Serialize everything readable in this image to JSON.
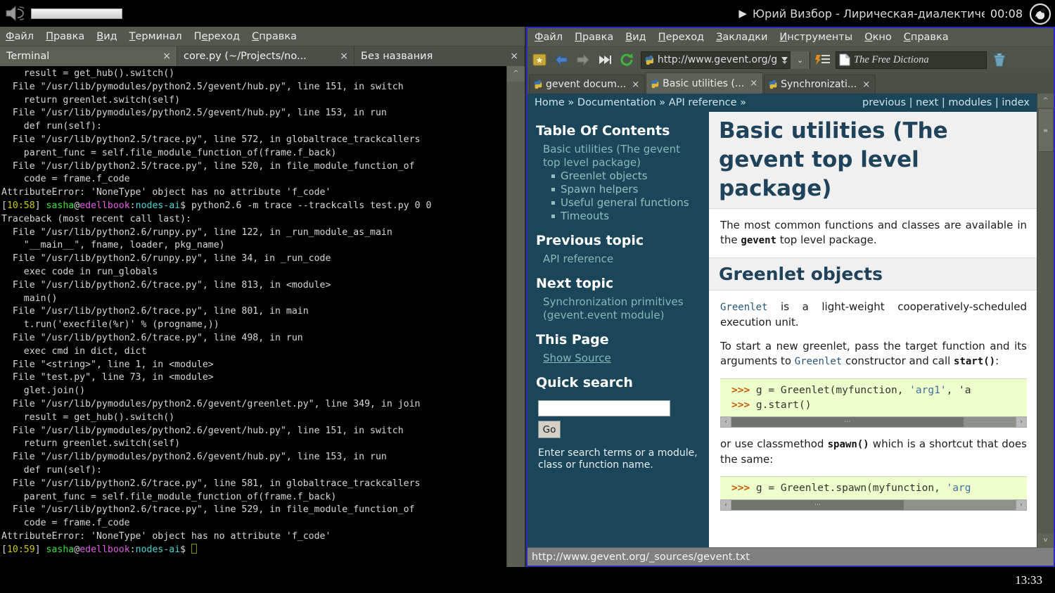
{
  "top_panel": {
    "speaker_icon": "speaker-icon",
    "volume_slider": "volume-slider",
    "play_glyph": "▶",
    "media_title": "Юрий Визбор - Лирическая-диалектическая",
    "media_time": "00:08",
    "tray_icon": "gnome-tray-icon"
  },
  "terminal": {
    "menu": [
      {
        "accel": "Ф",
        "rest": "айл"
      },
      {
        "accel": "П",
        "rest": "равка"
      },
      {
        "accel": "В",
        "rest": "ид"
      },
      {
        "accel": "Т",
        "rest": "ерминал"
      },
      {
        "accel": "П",
        "rest": "ереход",
        "accel_index": 1,
        "pre": "П"
      },
      {
        "accel": "С",
        "rest": "правка"
      }
    ],
    "menu_labels": [
      "Файл",
      "Правка",
      "Вид",
      "Терминал",
      "Переход",
      "Справка"
    ],
    "tabs": [
      {
        "label": "Terminal",
        "close": "×",
        "active": true
      },
      {
        "label": "core.py (~/Projects/no...",
        "close": "×",
        "active": false
      },
      {
        "label": "Без названия",
        "close": "×",
        "active": false
      }
    ],
    "scroll_up_glyph": "^",
    "lines": [
      {
        "segments": [
          {
            "t": "    result = get_hub().switch()",
            "c": "c-white"
          }
        ]
      },
      {
        "segments": [
          {
            "t": "  File \"/usr/lib/pymodules/python2.5/gevent/hub.py\", line 151, in switch",
            "c": "c-white"
          }
        ]
      },
      {
        "segments": [
          {
            "t": "    return greenlet.switch(self)",
            "c": "c-white"
          }
        ]
      },
      {
        "segments": [
          {
            "t": "  File \"/usr/lib/pymodules/python2.5/gevent/hub.py\", line 153, in run",
            "c": "c-white"
          }
        ]
      },
      {
        "segments": [
          {
            "t": "    def run(self):",
            "c": "c-white"
          }
        ]
      },
      {
        "segments": [
          {
            "t": "  File \"/usr/lib/python2.5/trace.py\", line 572, in globaltrace_trackcallers",
            "c": "c-white"
          }
        ]
      },
      {
        "segments": [
          {
            "t": "    parent_func = self.file_module_function_of(frame.f_back)",
            "c": "c-white"
          }
        ]
      },
      {
        "segments": [
          {
            "t": "  File \"/usr/lib/python2.5/trace.py\", line 520, in file_module_function_of",
            "c": "c-white"
          }
        ]
      },
      {
        "segments": [
          {
            "t": "    code = frame.f_code",
            "c": "c-white"
          }
        ]
      },
      {
        "segments": [
          {
            "t": "AttributeError: 'NoneType' object has no attribute 'f_code'",
            "c": "c-white"
          }
        ]
      },
      {
        "segments": [
          {
            "t": "[",
            "c": "c-white"
          },
          {
            "t": "10:58",
            "c": "c-yellow"
          },
          {
            "t": "] ",
            "c": "c-white"
          },
          {
            "t": "sasha",
            "c": "c-green"
          },
          {
            "t": "@",
            "c": "c-white"
          },
          {
            "t": "edellbook",
            "c": "c-magenta"
          },
          {
            "t": ":",
            "c": "c-white"
          },
          {
            "t": "nodes-ai",
            "c": "c-cyan"
          },
          {
            "t": "$ python2.6 -m trace --trackcalls test.py 0 0",
            "c": "c-white"
          }
        ]
      },
      {
        "segments": [
          {
            "t": "Traceback (most recent call last):",
            "c": "c-white"
          }
        ]
      },
      {
        "segments": [
          {
            "t": "  File \"/usr/lib/python2.6/runpy.py\", line 122, in _run_module_as_main",
            "c": "c-white"
          }
        ]
      },
      {
        "segments": [
          {
            "t": "    \"__main__\", fname, loader, pkg_name)",
            "c": "c-white"
          }
        ]
      },
      {
        "segments": [
          {
            "t": "  File \"/usr/lib/python2.6/runpy.py\", line 34, in _run_code",
            "c": "c-white"
          }
        ]
      },
      {
        "segments": [
          {
            "t": "    exec code in run_globals",
            "c": "c-white"
          }
        ]
      },
      {
        "segments": [
          {
            "t": "  File \"/usr/lib/python2.6/trace.py\", line 813, in <module>",
            "c": "c-white"
          }
        ]
      },
      {
        "segments": [
          {
            "t": "    main()",
            "c": "c-white"
          }
        ]
      },
      {
        "segments": [
          {
            "t": "  File \"/usr/lib/python2.6/trace.py\", line 801, in main",
            "c": "c-white"
          }
        ]
      },
      {
        "segments": [
          {
            "t": "    t.run('execfile(%r)' % (progname,))",
            "c": "c-white"
          }
        ]
      },
      {
        "segments": [
          {
            "t": "  File \"/usr/lib/python2.6/trace.py\", line 498, in run",
            "c": "c-white"
          }
        ]
      },
      {
        "segments": [
          {
            "t": "    exec cmd in dict, dict",
            "c": "c-white"
          }
        ]
      },
      {
        "segments": [
          {
            "t": "  File \"<string>\", line 1, in <module>",
            "c": "c-white"
          }
        ]
      },
      {
        "segments": [
          {
            "t": "  File \"test.py\", line 73, in <module>",
            "c": "c-white"
          }
        ]
      },
      {
        "segments": [
          {
            "t": "    glet.join()",
            "c": "c-white"
          }
        ]
      },
      {
        "segments": [
          {
            "t": "  File \"/usr/lib/pymodules/python2.6/gevent/greenlet.py\", line 349, in join",
            "c": "c-white"
          }
        ]
      },
      {
        "segments": [
          {
            "t": "    result = get_hub().switch()",
            "c": "c-white"
          }
        ]
      },
      {
        "segments": [
          {
            "t": "  File \"/usr/lib/pymodules/python2.6/gevent/hub.py\", line 151, in switch",
            "c": "c-white"
          }
        ]
      },
      {
        "segments": [
          {
            "t": "    return greenlet.switch(self)",
            "c": "c-white"
          }
        ]
      },
      {
        "segments": [
          {
            "t": "  File \"/usr/lib/pymodules/python2.6/gevent/hub.py\", line 153, in run",
            "c": "c-white"
          }
        ]
      },
      {
        "segments": [
          {
            "t": "    def run(self):",
            "c": "c-white"
          }
        ]
      },
      {
        "segments": [
          {
            "t": "  File \"/usr/lib/python2.6/trace.py\", line 581, in globaltrace_trackcallers",
            "c": "c-white"
          }
        ]
      },
      {
        "segments": [
          {
            "t": "    parent_func = self.file_module_function_of(frame.f_back)",
            "c": "c-white"
          }
        ]
      },
      {
        "segments": [
          {
            "t": "  File \"/usr/lib/python2.6/trace.py\", line 529, in file_module_function_of",
            "c": "c-white"
          }
        ]
      },
      {
        "segments": [
          {
            "t": "    code = frame.f_code",
            "c": "c-white"
          }
        ]
      },
      {
        "segments": [
          {
            "t": "AttributeError: 'NoneType' object has no attribute 'f_code'",
            "c": "c-white"
          }
        ]
      },
      {
        "segments": [
          {
            "t": "[",
            "c": "c-white"
          },
          {
            "t": "10:59",
            "c": "c-yellow"
          },
          {
            "t": "] ",
            "c": "c-white"
          },
          {
            "t": "sasha",
            "c": "c-green"
          },
          {
            "t": "@",
            "c": "c-white"
          },
          {
            "t": "edellbook",
            "c": "c-magenta"
          },
          {
            "t": ":",
            "c": "c-white"
          },
          {
            "t": "nodes-ai",
            "c": "c-cyan"
          },
          {
            "t": "$ ",
            "c": "c-white"
          }
        ],
        "cursor": true
      }
    ]
  },
  "browser": {
    "menu_labels": [
      "Файл",
      "Правка",
      "Вид",
      "Переход",
      "Закладки",
      "Инструменты",
      "Окно",
      "Справка"
    ],
    "toolbar": {
      "new_tab_icon": "new-tab-star-icon",
      "back_icon": "back-arrow-icon",
      "forward_icon": "forward-arrow-icon",
      "skip_icon": "skip-forward-icon",
      "reload_icon": "reload-icon",
      "url_favicon": "python-favicon",
      "url_value": "http://www.gevent.org/g",
      "url_go_icon": "go-arrow-icon",
      "url_dropdown_icon": "chevron-down-icon",
      "bookmarks_menu_icon": "bookmarks-list-icon",
      "bookmark_page_icon": "page-icon",
      "bookmark_label": "The Free Dictiona",
      "trash_icon": "trash-icon"
    },
    "tabs": [
      {
        "label": "gevent docum...",
        "favicon": "python-favicon",
        "close": "×",
        "active": false
      },
      {
        "label": "Basic utilities (...",
        "favicon": "python-favicon",
        "close": "×",
        "active": true
      },
      {
        "label": "Synchronizati...",
        "favicon": "python-favicon",
        "close": "×",
        "active": false
      }
    ],
    "status_text": "http://www.gevent.org/_sources/gevent.txt"
  },
  "page": {
    "breadcrumb": "Home » Documentation » API reference »",
    "nav_links": "previous | next | modules | index",
    "sidebar": {
      "toc_heading": "Table Of Contents",
      "toc_top": "Basic utilities (The gevent top level package)",
      "toc_items": [
        "Greenlet objects",
        "Spawn helpers",
        "Useful general functions",
        "Timeouts"
      ],
      "prev_heading": "Previous topic",
      "prev_link": "API reference",
      "next_heading": "Next topic",
      "next_link": "Synchronization primitives (gevent.event module)",
      "thispage_heading": "This Page",
      "show_source": "Show Source",
      "quicksearch_heading": "Quick search",
      "search_value": "",
      "search_placeholder": "",
      "go_label": "Go",
      "search_hint": "Enter search terms or a module, class or function name."
    },
    "content": {
      "h1": "Basic utilities (The gevent top level package)",
      "p1_a": "The most common functions and classes are available in the ",
      "p1_b": "gevent",
      "p1_c": " top level package.",
      "h2": "Greenlet objects",
      "p2_a": "Greenlet",
      "p2_b": " is a light-weight cooperatively-scheduled execution unit.",
      "p3_a": "To start a new greenlet, pass the target function and its arguments to ",
      "p3_b": "Greenlet",
      "p3_c": " constructor and call ",
      "p3_d": "start()",
      "p3_e": ":",
      "code1_line1_prompt": ">>> ",
      "code1_line1_body": "g = Greenlet(myfunction, ",
      "code1_line1_str": "'arg1'",
      "code1_line1_tail": ", 'a",
      "code1_line2_prompt": ">>> ",
      "code1_line2_body": "g.start()",
      "p4_a": "or use classmethod ",
      "p4_b": "spawn()",
      "p4_c": " which is a shortcut that does the same:",
      "code2_prompt": ">>> ",
      "code2_body": "g = Greenlet.spawn(myfunction, ",
      "code2_str": "'arg",
      "hscroll_left": "‹",
      "hscroll_right": "›",
      "hscroll_grip": "⋯"
    },
    "vscroll": {
      "up": "^",
      "down": "v",
      "grip": "≡"
    }
  },
  "taskbar": {
    "clock": "13:33"
  },
  "colors": {
    "sphinx_sidebar": "#1b4659",
    "heading": "#20435c",
    "code_bg": "#eeffcc",
    "terminal_bg": "#000000",
    "panel_bg": "#53594f"
  }
}
